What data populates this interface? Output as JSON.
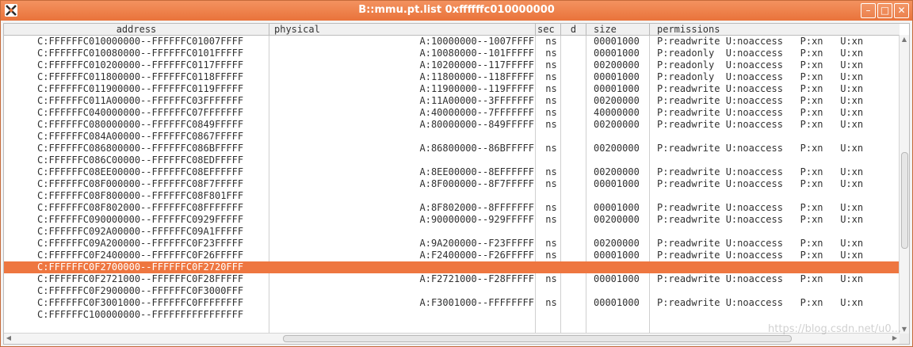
{
  "window": {
    "title": "B::mmu.pt.list 0xffffffc010000000"
  },
  "columns": [
    {
      "key": "address",
      "label": "address"
    },
    {
      "key": "physical",
      "label": "physical"
    },
    {
      "key": "sec",
      "label": "sec"
    },
    {
      "key": "d",
      "label": "d"
    },
    {
      "key": "size",
      "label": "size"
    },
    {
      "key": "permissions",
      "label": "permissions"
    }
  ],
  "rows": [
    {
      "address": "C:FFFFFFC010000000--FFFFFFC01007FFFF",
      "physical": "A:10000000--1007FFFF",
      "sec": "ns",
      "size": "00001000",
      "perm": "P:readwrite U:noaccess   P:xn   U:xn"
    },
    {
      "address": "C:FFFFFFC010080000--FFFFFFC0101FFFFF",
      "physical": "A:10080000--101FFFFF",
      "sec": "ns",
      "size": "00001000",
      "perm": "P:readonly  U:noaccess   P:xn   U:xn"
    },
    {
      "address": "C:FFFFFFC010200000--FFFFFFC0117FFFFF",
      "physical": "A:10200000--117FFFFF",
      "sec": "ns",
      "size": "00200000",
      "perm": "P:readonly  U:noaccess   P:xn   U:xn"
    },
    {
      "address": "C:FFFFFFC011800000--FFFFFFC0118FFFFF",
      "physical": "A:11800000--118FFFFF",
      "sec": "ns",
      "size": "00001000",
      "perm": "P:readonly  U:noaccess   P:xn   U:xn"
    },
    {
      "address": "C:FFFFFFC011900000--FFFFFFC0119FFFFF",
      "physical": "A:11900000--119FFFFF",
      "sec": "ns",
      "size": "00001000",
      "perm": "P:readwrite U:noaccess   P:xn   U:xn"
    },
    {
      "address": "C:FFFFFFC011A00000--FFFFFFC03FFFFFFF",
      "physical": "A:11A00000--3FFFFFFF",
      "sec": "ns",
      "size": "00200000",
      "perm": "P:readwrite U:noaccess   P:xn   U:xn"
    },
    {
      "address": "C:FFFFFFC040000000--FFFFFFC07FFFFFFF",
      "physical": "A:40000000--7FFFFFFF",
      "sec": "ns",
      "size": "40000000",
      "perm": "P:readwrite U:noaccess   P:xn   U:xn"
    },
    {
      "address": "C:FFFFFFC080000000--FFFFFFC0849FFFFF",
      "physical": "A:80000000--849FFFFF",
      "sec": "ns",
      "size": "00200000",
      "perm": "P:readwrite U:noaccess   P:xn   U:xn"
    },
    {
      "address": "C:FFFFFFC084A00000--FFFFFFC0867FFFFF",
      "physical": "",
      "sec": "",
      "size": "",
      "perm": ""
    },
    {
      "address": "C:FFFFFFC086800000--FFFFFFC086BFFFFF",
      "physical": "A:86800000--86BFFFFF",
      "sec": "ns",
      "size": "00200000",
      "perm": "P:readwrite U:noaccess   P:xn   U:xn"
    },
    {
      "address": "C:FFFFFFC086C00000--FFFFFFC08EDFFFFF",
      "physical": "",
      "sec": "",
      "size": "",
      "perm": ""
    },
    {
      "address": "C:FFFFFFC08EE00000--FFFFFFC08EFFFFFF",
      "physical": "A:8EE00000--8EFFFFFF",
      "sec": "ns",
      "size": "00200000",
      "perm": "P:readwrite U:noaccess   P:xn   U:xn"
    },
    {
      "address": "C:FFFFFFC08F000000--FFFFFFC08F7FFFFF",
      "physical": "A:8F000000--8F7FFFFF",
      "sec": "ns",
      "size": "00001000",
      "perm": "P:readwrite U:noaccess   P:xn   U:xn"
    },
    {
      "address": "C:FFFFFFC08F800000--FFFFFFC08F801FFF",
      "physical": "",
      "sec": "",
      "size": "",
      "perm": ""
    },
    {
      "address": "C:FFFFFFC08F802000--FFFFFFC08FFFFFFF",
      "physical": "A:8F802000--8FFFFFFF",
      "sec": "ns",
      "size": "00001000",
      "perm": "P:readwrite U:noaccess   P:xn   U:xn"
    },
    {
      "address": "C:FFFFFFC090000000--FFFFFFC0929FFFFF",
      "physical": "A:90000000--929FFFFF",
      "sec": "ns",
      "size": "00200000",
      "perm": "P:readwrite U:noaccess   P:xn   U:xn"
    },
    {
      "address": "C:FFFFFFC092A00000--FFFFFFC09A1FFFFF",
      "physical": "",
      "sec": "",
      "size": "",
      "perm": ""
    },
    {
      "address": "C:FFFFFFC09A200000--FFFFFFC0F23FFFFF",
      "physical": "A:9A200000--F23FFFFF",
      "sec": "ns",
      "size": "00200000",
      "perm": "P:readwrite U:noaccess   P:xn   U:xn"
    },
    {
      "address": "C:FFFFFFC0F2400000--FFFFFFC0F26FFFFF",
      "physical": "A:F2400000--F26FFFFF",
      "sec": "ns",
      "size": "00001000",
      "perm": "P:readwrite U:noaccess   P:xn   U:xn"
    },
    {
      "address": "C:FFFFFFC0F2700000--FFFFFFC0F2720FFF",
      "physical": "",
      "sec": "",
      "size": "",
      "perm": "",
      "selected": true
    },
    {
      "address": "C:FFFFFFC0F2721000--FFFFFFC0F28FFFFF",
      "physical": "A:F2721000--F28FFFFF",
      "sec": "ns",
      "size": "00001000",
      "perm": "P:readwrite U:noaccess   P:xn   U:xn"
    },
    {
      "address": "C:FFFFFFC0F2900000--FFFFFFC0F3000FFF",
      "physical": "",
      "sec": "",
      "size": "",
      "perm": ""
    },
    {
      "address": "C:FFFFFFC0F3001000--FFFFFFC0FFFFFFFF",
      "physical": "A:F3001000--FFFFFFFF",
      "sec": "ns",
      "size": "00001000",
      "perm": "P:readwrite U:noaccess   P:xn   U:xn"
    },
    {
      "address": "C:FFFFFFC100000000--FFFFFFFFFFFFFFFF",
      "physical": "",
      "sec": "",
      "size": "",
      "perm": ""
    }
  ],
  "icons": {
    "app": "trace32-icon",
    "minimize": "minimize-icon",
    "maximize": "maximize-icon",
    "close": "close-icon"
  },
  "colors": {
    "titlebar": "#e9733b",
    "selection": "#ee7640"
  },
  "watermark": "https://blog.csdn.net/u0..."
}
